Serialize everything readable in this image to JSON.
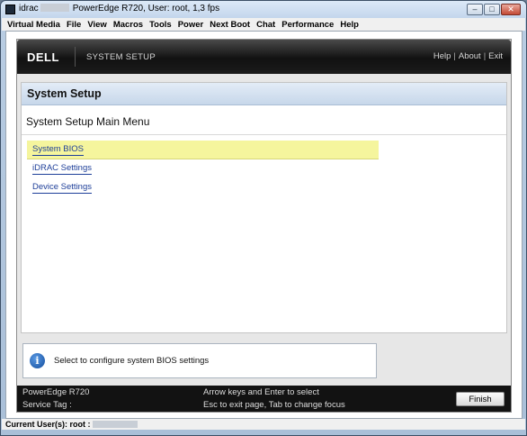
{
  "window": {
    "title_prefix": "idrac",
    "title_suffix": "PowerEdge R720, User: root, 1,3 fps",
    "icon": "console-app-icon",
    "controls": {
      "minimize": "–",
      "maximize": "□",
      "close": "✕"
    }
  },
  "menubar": {
    "items": [
      "Virtual Media",
      "File",
      "View",
      "Macros",
      "Tools",
      "Power",
      "Next Boot",
      "Chat",
      "Performance",
      "Help"
    ]
  },
  "header": {
    "logo": "DELL",
    "app_name": "SYSTEM SETUP",
    "links": {
      "help": "Help",
      "about": "About",
      "exit": "Exit",
      "separator": "|"
    }
  },
  "page": {
    "title": "System Setup",
    "menu_title": "System Setup Main Menu",
    "items": [
      {
        "label": "System BIOS",
        "selected": true
      },
      {
        "label": "iDRAC Settings",
        "selected": false
      },
      {
        "label": "Device Settings",
        "selected": false
      }
    ]
  },
  "help": {
    "icon": "info-icon",
    "text": "Select to configure system BIOS settings"
  },
  "footer": {
    "model": "PowerEdge R720",
    "service_tag_label": "Service Tag :",
    "hint_line1": "Arrow keys and Enter to select",
    "hint_line2": "Esc to exit page, Tab to change focus",
    "finish_label": "Finish"
  },
  "statusbar": {
    "label": "Current User(s): root :"
  },
  "colors": {
    "selection_highlight": "#f5f59d",
    "link": "#1e3f99",
    "header_bg": "#111111",
    "page_head_bg": "#c7d7ea"
  }
}
